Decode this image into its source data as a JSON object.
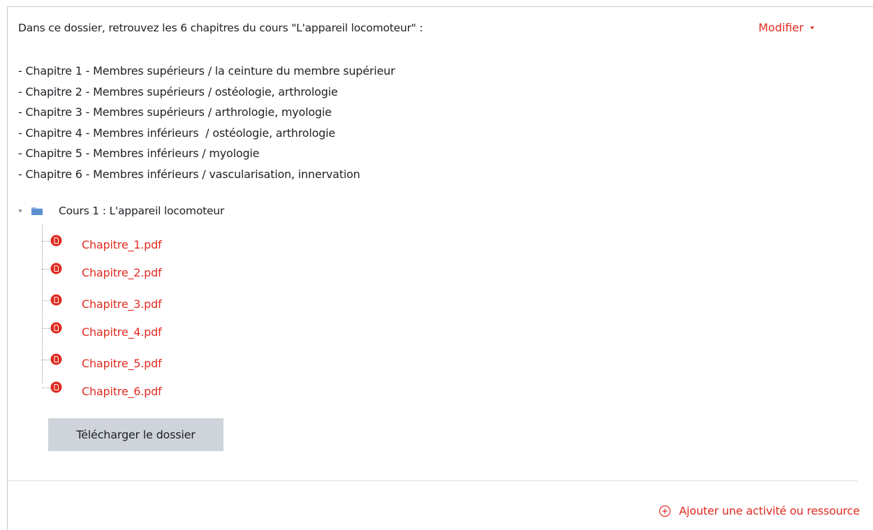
{
  "section": {
    "intro": "Dans ce dossier, retrouvez les 6 chapitres du cours \"L'appareil locomoteur\" :",
    "edit_menu_label": "Modifier",
    "chapters": [
      "- Chapitre 1 - Membres supérieurs / la ceinture du membre supérieur",
      "- Chapitre 2 - Membres supérieurs / ostéologie, arthrologie",
      "- Chapitre 3 - Membres supérieurs / arthrologie, myologie",
      "- Chapitre 4 - Membres inférieurs  / ostéologie, arthrologie",
      "- Chapitre 5 - Membres inférieurs / myologie",
      "- Chapitre 6 - Membres inférieurs / vascularisation, innervation"
    ]
  },
  "folder": {
    "name": "Cours 1 : L'appareil locomoteur",
    "icon": "folder-icon",
    "files": [
      {
        "name": "Chapitre_1.pdf",
        "icon": "pdf-icon"
      },
      {
        "name": "Chapitre_2.pdf",
        "icon": "pdf-icon"
      },
      {
        "name": "Chapitre_3.pdf",
        "icon": "pdf-icon"
      },
      {
        "name": "Chapitre_4.pdf",
        "icon": "pdf-icon"
      },
      {
        "name": "Chapitre_5.pdf",
        "icon": "pdf-icon"
      },
      {
        "name": "Chapitre_6.pdf",
        "icon": "pdf-icon"
      }
    ],
    "download_label": "Télécharger le dossier"
  },
  "footer": {
    "add_activity_label": "Ajouter une activité ou ressource",
    "add_icon": "plus-circle-icon"
  },
  "colors": {
    "accent": "#e02b20",
    "button_bg": "#ced4da",
    "folder": "#7fa7d8",
    "text": "#1d2125"
  }
}
